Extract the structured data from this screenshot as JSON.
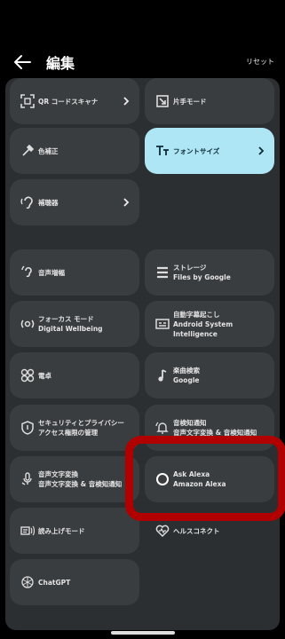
{
  "header": {
    "title": "編集",
    "reset_label": "リセット"
  },
  "tiles": [
    {
      "label": "QR コードスキャナ",
      "sub": "",
      "icon": "qr-scan-icon",
      "chevron": true
    },
    {
      "label": "片手モード",
      "sub": "",
      "icon": "one-hand-mode-icon",
      "chevron": false
    },
    {
      "label": "色補正",
      "sub": "",
      "icon": "eyedropper-icon",
      "chevron": false
    },
    {
      "label": "フォントサイズ",
      "sub": "",
      "icon": "font-size-icon",
      "chevron": true,
      "highlighted": true
    },
    {
      "label": "補聴器",
      "sub": "",
      "icon": "hearing-aid-icon",
      "chevron": true
    },
    {
      "label": "音声増幅",
      "sub": "",
      "icon": "sound-amplifier-icon",
      "chevron": false
    },
    {
      "label": "ストレージ",
      "sub": "Files by Google",
      "icon": "storage-icon",
      "chevron": false
    },
    {
      "label": "フォーカス モード",
      "sub": "Digital Wellbeing",
      "icon": "focus-mode-icon",
      "chevron": false
    },
    {
      "label": "自動字幕起こし",
      "sub": "Android System Intelligence",
      "icon": "live-caption-icon",
      "chevron": false
    },
    {
      "label": "電卓",
      "sub": "",
      "icon": "calculator-icon",
      "chevron": false
    },
    {
      "label": "楽曲検索",
      "sub": "Google",
      "icon": "music-note-icon",
      "chevron": false
    },
    {
      "label": "セキュリティとプライバシー",
      "sub": "アクセス権限の管理",
      "icon": "shield-icon",
      "chevron": false
    },
    {
      "label": "音検知通知",
      "sub": "音声文字変換 & 音検知通知",
      "icon": "sound-notification-icon",
      "chevron": false
    },
    {
      "label": "音声文字変換",
      "sub": "音声文字変換 & 音検知通知",
      "icon": "live-transcribe-icon",
      "chevron": false
    },
    {
      "label": "Ask Alexa",
      "sub": "Amazon Alexa",
      "icon": "alexa-ring-icon",
      "chevron": false
    },
    {
      "label": "読み上げモード",
      "sub": "",
      "icon": "reading-mode-icon",
      "chevron": false
    },
    {
      "label": "ヘルスコネクト",
      "sub": "",
      "icon": "health-connect-icon",
      "chevron": false
    },
    {
      "label": "ChatGPT",
      "sub": "",
      "icon": "chatgpt-icon",
      "chevron": false
    }
  ]
}
